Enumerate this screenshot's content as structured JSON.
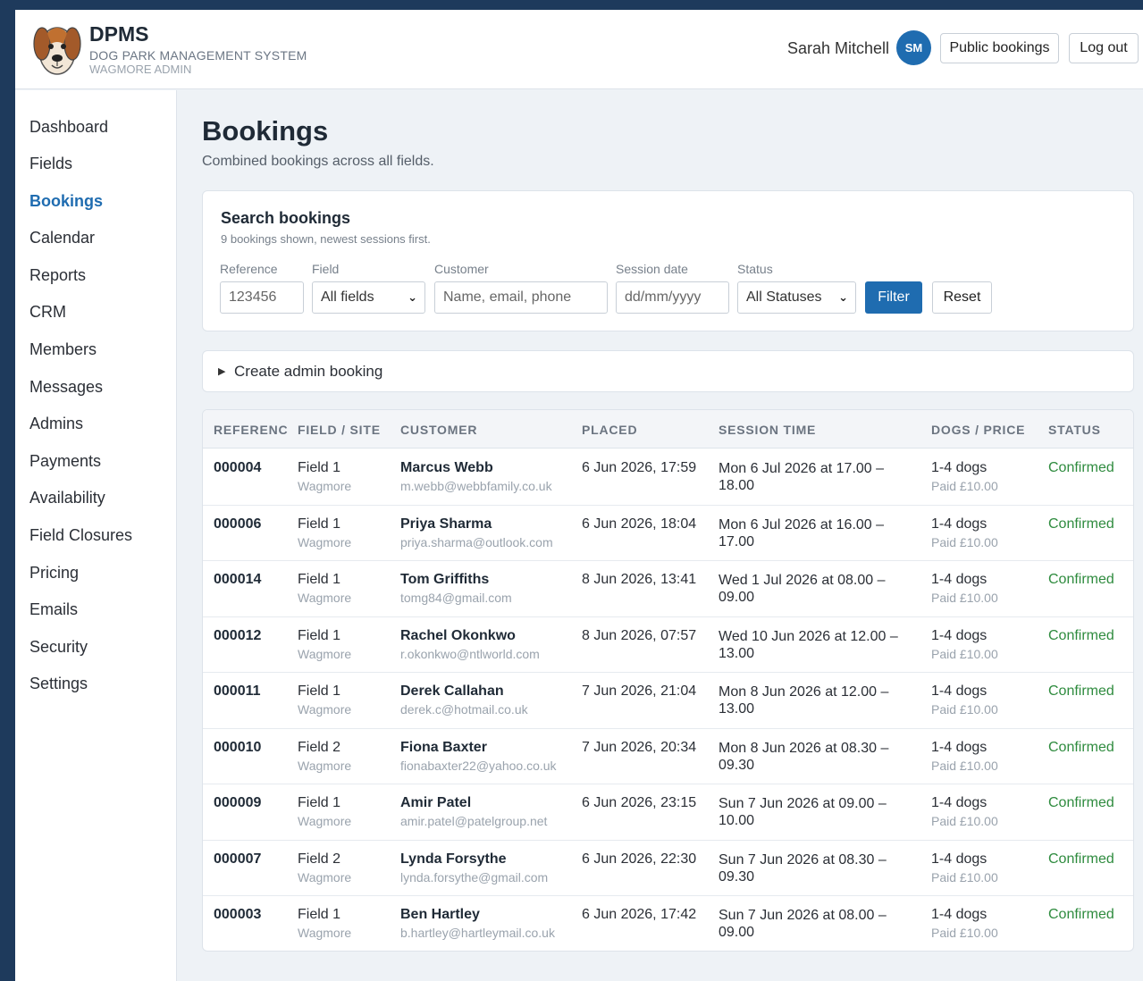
{
  "header": {
    "brand_title": "DPMS",
    "brand_subtitle": "DOG PARK MANAGEMENT SYSTEM",
    "brand_org": "WAGMORE ADMIN",
    "user_name": "Sarah Mitchell",
    "avatar_initials": "SM",
    "public_bookings_label": "Public bookings",
    "logout_label": "Log out",
    "logo_icon": "dog-face-icon"
  },
  "sidebar": {
    "items": [
      {
        "label": "Dashboard",
        "active": false
      },
      {
        "label": "Fields",
        "active": false
      },
      {
        "label": "Bookings",
        "active": true
      },
      {
        "label": "Calendar",
        "active": false
      },
      {
        "label": "Reports",
        "active": false
      },
      {
        "label": "CRM",
        "active": false
      },
      {
        "label": "Members",
        "active": false
      },
      {
        "label": "Messages",
        "active": false
      },
      {
        "label": "Admins",
        "active": false
      },
      {
        "label": "Payments",
        "active": false
      },
      {
        "label": "Availability",
        "active": false
      },
      {
        "label": "Field Closures",
        "active": false
      },
      {
        "label": "Pricing",
        "active": false
      },
      {
        "label": "Emails",
        "active": false
      },
      {
        "label": "Security",
        "active": false
      },
      {
        "label": "Settings",
        "active": false
      }
    ]
  },
  "main": {
    "title": "Bookings",
    "subtitle": "Combined bookings across all fields."
  },
  "search": {
    "title": "Search bookings",
    "meta": "9 bookings shown, newest sessions first.",
    "reference_label": "Reference",
    "reference_placeholder": "123456",
    "field_label": "Field",
    "field_value": "All fields",
    "customer_label": "Customer",
    "customer_placeholder": "Name, email, phone",
    "date_label": "Session date",
    "date_placeholder": "dd/mm/yyyy",
    "status_label": "Status",
    "status_value": "All Statuses",
    "filter_label": "Filter",
    "reset_label": "Reset"
  },
  "create": {
    "label": "Create admin booking"
  },
  "table": {
    "headers": [
      "REFERENCE",
      "FIELD / SITE",
      "CUSTOMER",
      "PLACED",
      "SESSION TIME",
      "DOGS / PRICE",
      "STATUS"
    ],
    "rows": [
      {
        "ref": "000004",
        "field": "Field 1",
        "site": "Wagmore",
        "name": "Marcus Webb",
        "email": "m.webb@webbfamily.co.uk",
        "placed": "6 Jun 2026, 17:59",
        "session": "Mon 6 Jul 2026 at 17.00 – 18.00",
        "dogs": "1-4 dogs",
        "price": "Paid £10.00",
        "status": "Confirmed"
      },
      {
        "ref": "000006",
        "field": "Field 1",
        "site": "Wagmore",
        "name": "Priya Sharma",
        "email": "priya.sharma@outlook.com",
        "placed": "6 Jun 2026, 18:04",
        "session": "Mon 6 Jul 2026 at 16.00 – 17.00",
        "dogs": "1-4 dogs",
        "price": "Paid £10.00",
        "status": "Confirmed"
      },
      {
        "ref": "000014",
        "field": "Field 1",
        "site": "Wagmore",
        "name": "Tom Griffiths",
        "email": "tomg84@gmail.com",
        "placed": "8 Jun 2026, 13:41",
        "session": "Wed 1 Jul 2026 at 08.00 – 09.00",
        "dogs": "1-4 dogs",
        "price": "Paid £10.00",
        "status": "Confirmed"
      },
      {
        "ref": "000012",
        "field": "Field 1",
        "site": "Wagmore",
        "name": "Rachel Okonkwo",
        "email": "r.okonkwo@ntlworld.com",
        "placed": "8 Jun 2026, 07:57",
        "session": "Wed 10 Jun 2026 at 12.00 – 13.00",
        "dogs": "1-4 dogs",
        "price": "Paid £10.00",
        "status": "Confirmed"
      },
      {
        "ref": "000011",
        "field": "Field 1",
        "site": "Wagmore",
        "name": "Derek Callahan",
        "email": "derek.c@hotmail.co.uk",
        "placed": "7 Jun 2026, 21:04",
        "session": "Mon 8 Jun 2026 at 12.00 – 13.00",
        "dogs": "1-4 dogs",
        "price": "Paid £10.00",
        "status": "Confirmed"
      },
      {
        "ref": "000010",
        "field": "Field 2",
        "site": "Wagmore",
        "name": "Fiona Baxter",
        "email": "fionabaxter22@yahoo.co.uk",
        "placed": "7 Jun 2026, 20:34",
        "session": "Mon 8 Jun 2026 at 08.30 – 09.30",
        "dogs": "1-4 dogs",
        "price": "Paid £10.00",
        "status": "Confirmed"
      },
      {
        "ref": "000009",
        "field": "Field 1",
        "site": "Wagmore",
        "name": "Amir Patel",
        "email": "amir.patel@patelgroup.net",
        "placed": "6 Jun 2026, 23:15",
        "session": "Sun 7 Jun 2026 at 09.00 – 10.00",
        "dogs": "1-4 dogs",
        "price": "Paid £10.00",
        "status": "Confirmed"
      },
      {
        "ref": "000007",
        "field": "Field 2",
        "site": "Wagmore",
        "name": "Lynda Forsythe",
        "email": "lynda.forsythe@gmail.com",
        "placed": "6 Jun 2026, 22:30",
        "session": "Sun 7 Jun 2026 at 08.30 – 09.30",
        "dogs": "1-4 dogs",
        "price": "Paid £10.00",
        "status": "Confirmed"
      },
      {
        "ref": "000003",
        "field": "Field 1",
        "site": "Wagmore",
        "name": "Ben Hartley",
        "email": "b.hartley@hartleymail.co.uk",
        "placed": "6 Jun 2026, 17:42",
        "session": "Sun 7 Jun 2026 at 08.00 – 09.00",
        "dogs": "1-4 dogs",
        "price": "Paid £10.00",
        "status": "Confirmed"
      }
    ]
  },
  "colors": {
    "accent": "#1f6cb0",
    "status_confirmed": "#2e8b3e",
    "frame": "#1e3a5c"
  }
}
